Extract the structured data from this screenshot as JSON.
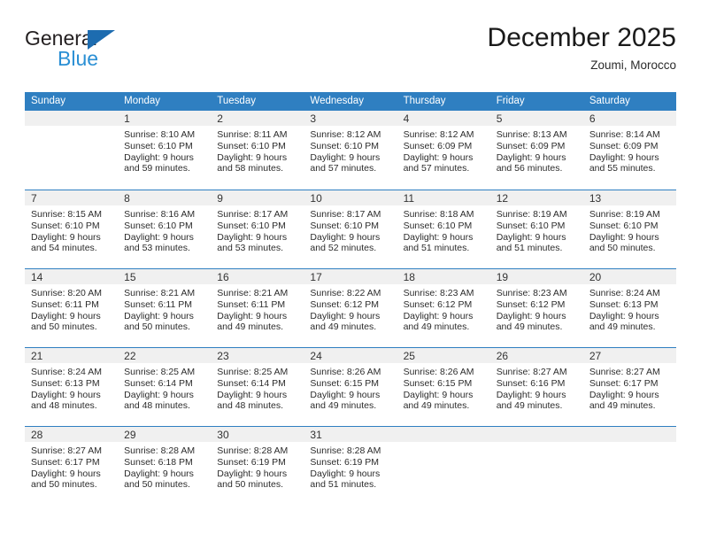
{
  "brand": {
    "name_part1": "General",
    "name_part2": "Blue",
    "triangle_icon": "triangle-icon",
    "color_dark": "#231f20",
    "color_blue": "#2a8fd4",
    "color_triangle": "#1d6cb0"
  },
  "header": {
    "title": "December 2025",
    "subtitle": "Zoumi, Morocco"
  },
  "theme": {
    "header_bg": "#2f7fc1",
    "header_text": "#ffffff",
    "day_band_bg": "#f0f0f0",
    "cell_bg": "#ffffff",
    "row_divider": "#2f7fc1",
    "body_text": "#2c2c2c"
  },
  "weekdays": [
    "Sunday",
    "Monday",
    "Tuesday",
    "Wednesday",
    "Thursday",
    "Friday",
    "Saturday"
  ],
  "weeks": [
    [
      {
        "day": "",
        "lines": []
      },
      {
        "day": "1",
        "lines": [
          "Sunrise: 8:10 AM",
          "Sunset: 6:10 PM",
          "Daylight: 9 hours",
          "and 59 minutes."
        ]
      },
      {
        "day": "2",
        "lines": [
          "Sunrise: 8:11 AM",
          "Sunset: 6:10 PM",
          "Daylight: 9 hours",
          "and 58 minutes."
        ]
      },
      {
        "day": "3",
        "lines": [
          "Sunrise: 8:12 AM",
          "Sunset: 6:10 PM",
          "Daylight: 9 hours",
          "and 57 minutes."
        ]
      },
      {
        "day": "4",
        "lines": [
          "Sunrise: 8:12 AM",
          "Sunset: 6:09 PM",
          "Daylight: 9 hours",
          "and 57 minutes."
        ]
      },
      {
        "day": "5",
        "lines": [
          "Sunrise: 8:13 AM",
          "Sunset: 6:09 PM",
          "Daylight: 9 hours",
          "and 56 minutes."
        ]
      },
      {
        "day": "6",
        "lines": [
          "Sunrise: 8:14 AM",
          "Sunset: 6:09 PM",
          "Daylight: 9 hours",
          "and 55 minutes."
        ]
      }
    ],
    [
      {
        "day": "7",
        "lines": [
          "Sunrise: 8:15 AM",
          "Sunset: 6:10 PM",
          "Daylight: 9 hours",
          "and 54 minutes."
        ]
      },
      {
        "day": "8",
        "lines": [
          "Sunrise: 8:16 AM",
          "Sunset: 6:10 PM",
          "Daylight: 9 hours",
          "and 53 minutes."
        ]
      },
      {
        "day": "9",
        "lines": [
          "Sunrise: 8:17 AM",
          "Sunset: 6:10 PM",
          "Daylight: 9 hours",
          "and 53 minutes."
        ]
      },
      {
        "day": "10",
        "lines": [
          "Sunrise: 8:17 AM",
          "Sunset: 6:10 PM",
          "Daylight: 9 hours",
          "and 52 minutes."
        ]
      },
      {
        "day": "11",
        "lines": [
          "Sunrise: 8:18 AM",
          "Sunset: 6:10 PM",
          "Daylight: 9 hours",
          "and 51 minutes."
        ]
      },
      {
        "day": "12",
        "lines": [
          "Sunrise: 8:19 AM",
          "Sunset: 6:10 PM",
          "Daylight: 9 hours",
          "and 51 minutes."
        ]
      },
      {
        "day": "13",
        "lines": [
          "Sunrise: 8:19 AM",
          "Sunset: 6:10 PM",
          "Daylight: 9 hours",
          "and 50 minutes."
        ]
      }
    ],
    [
      {
        "day": "14",
        "lines": [
          "Sunrise: 8:20 AM",
          "Sunset: 6:11 PM",
          "Daylight: 9 hours",
          "and 50 minutes."
        ]
      },
      {
        "day": "15",
        "lines": [
          "Sunrise: 8:21 AM",
          "Sunset: 6:11 PM",
          "Daylight: 9 hours",
          "and 50 minutes."
        ]
      },
      {
        "day": "16",
        "lines": [
          "Sunrise: 8:21 AM",
          "Sunset: 6:11 PM",
          "Daylight: 9 hours",
          "and 49 minutes."
        ]
      },
      {
        "day": "17",
        "lines": [
          "Sunrise: 8:22 AM",
          "Sunset: 6:12 PM",
          "Daylight: 9 hours",
          "and 49 minutes."
        ]
      },
      {
        "day": "18",
        "lines": [
          "Sunrise: 8:23 AM",
          "Sunset: 6:12 PM",
          "Daylight: 9 hours",
          "and 49 minutes."
        ]
      },
      {
        "day": "19",
        "lines": [
          "Sunrise: 8:23 AM",
          "Sunset: 6:12 PM",
          "Daylight: 9 hours",
          "and 49 minutes."
        ]
      },
      {
        "day": "20",
        "lines": [
          "Sunrise: 8:24 AM",
          "Sunset: 6:13 PM",
          "Daylight: 9 hours",
          "and 49 minutes."
        ]
      }
    ],
    [
      {
        "day": "21",
        "lines": [
          "Sunrise: 8:24 AM",
          "Sunset: 6:13 PM",
          "Daylight: 9 hours",
          "and 48 minutes."
        ]
      },
      {
        "day": "22",
        "lines": [
          "Sunrise: 8:25 AM",
          "Sunset: 6:14 PM",
          "Daylight: 9 hours",
          "and 48 minutes."
        ]
      },
      {
        "day": "23",
        "lines": [
          "Sunrise: 8:25 AM",
          "Sunset: 6:14 PM",
          "Daylight: 9 hours",
          "and 48 minutes."
        ]
      },
      {
        "day": "24",
        "lines": [
          "Sunrise: 8:26 AM",
          "Sunset: 6:15 PM",
          "Daylight: 9 hours",
          "and 49 minutes."
        ]
      },
      {
        "day": "25",
        "lines": [
          "Sunrise: 8:26 AM",
          "Sunset: 6:15 PM",
          "Daylight: 9 hours",
          "and 49 minutes."
        ]
      },
      {
        "day": "26",
        "lines": [
          "Sunrise: 8:27 AM",
          "Sunset: 6:16 PM",
          "Daylight: 9 hours",
          "and 49 minutes."
        ]
      },
      {
        "day": "27",
        "lines": [
          "Sunrise: 8:27 AM",
          "Sunset: 6:17 PM",
          "Daylight: 9 hours",
          "and 49 minutes."
        ]
      }
    ],
    [
      {
        "day": "28",
        "lines": [
          "Sunrise: 8:27 AM",
          "Sunset: 6:17 PM",
          "Daylight: 9 hours",
          "and 50 minutes."
        ]
      },
      {
        "day": "29",
        "lines": [
          "Sunrise: 8:28 AM",
          "Sunset: 6:18 PM",
          "Daylight: 9 hours",
          "and 50 minutes."
        ]
      },
      {
        "day": "30",
        "lines": [
          "Sunrise: 8:28 AM",
          "Sunset: 6:19 PM",
          "Daylight: 9 hours",
          "and 50 minutes."
        ]
      },
      {
        "day": "31",
        "lines": [
          "Sunrise: 8:28 AM",
          "Sunset: 6:19 PM",
          "Daylight: 9 hours",
          "and 51 minutes."
        ]
      },
      {
        "day": "",
        "lines": []
      },
      {
        "day": "",
        "lines": []
      },
      {
        "day": "",
        "lines": []
      }
    ]
  ]
}
